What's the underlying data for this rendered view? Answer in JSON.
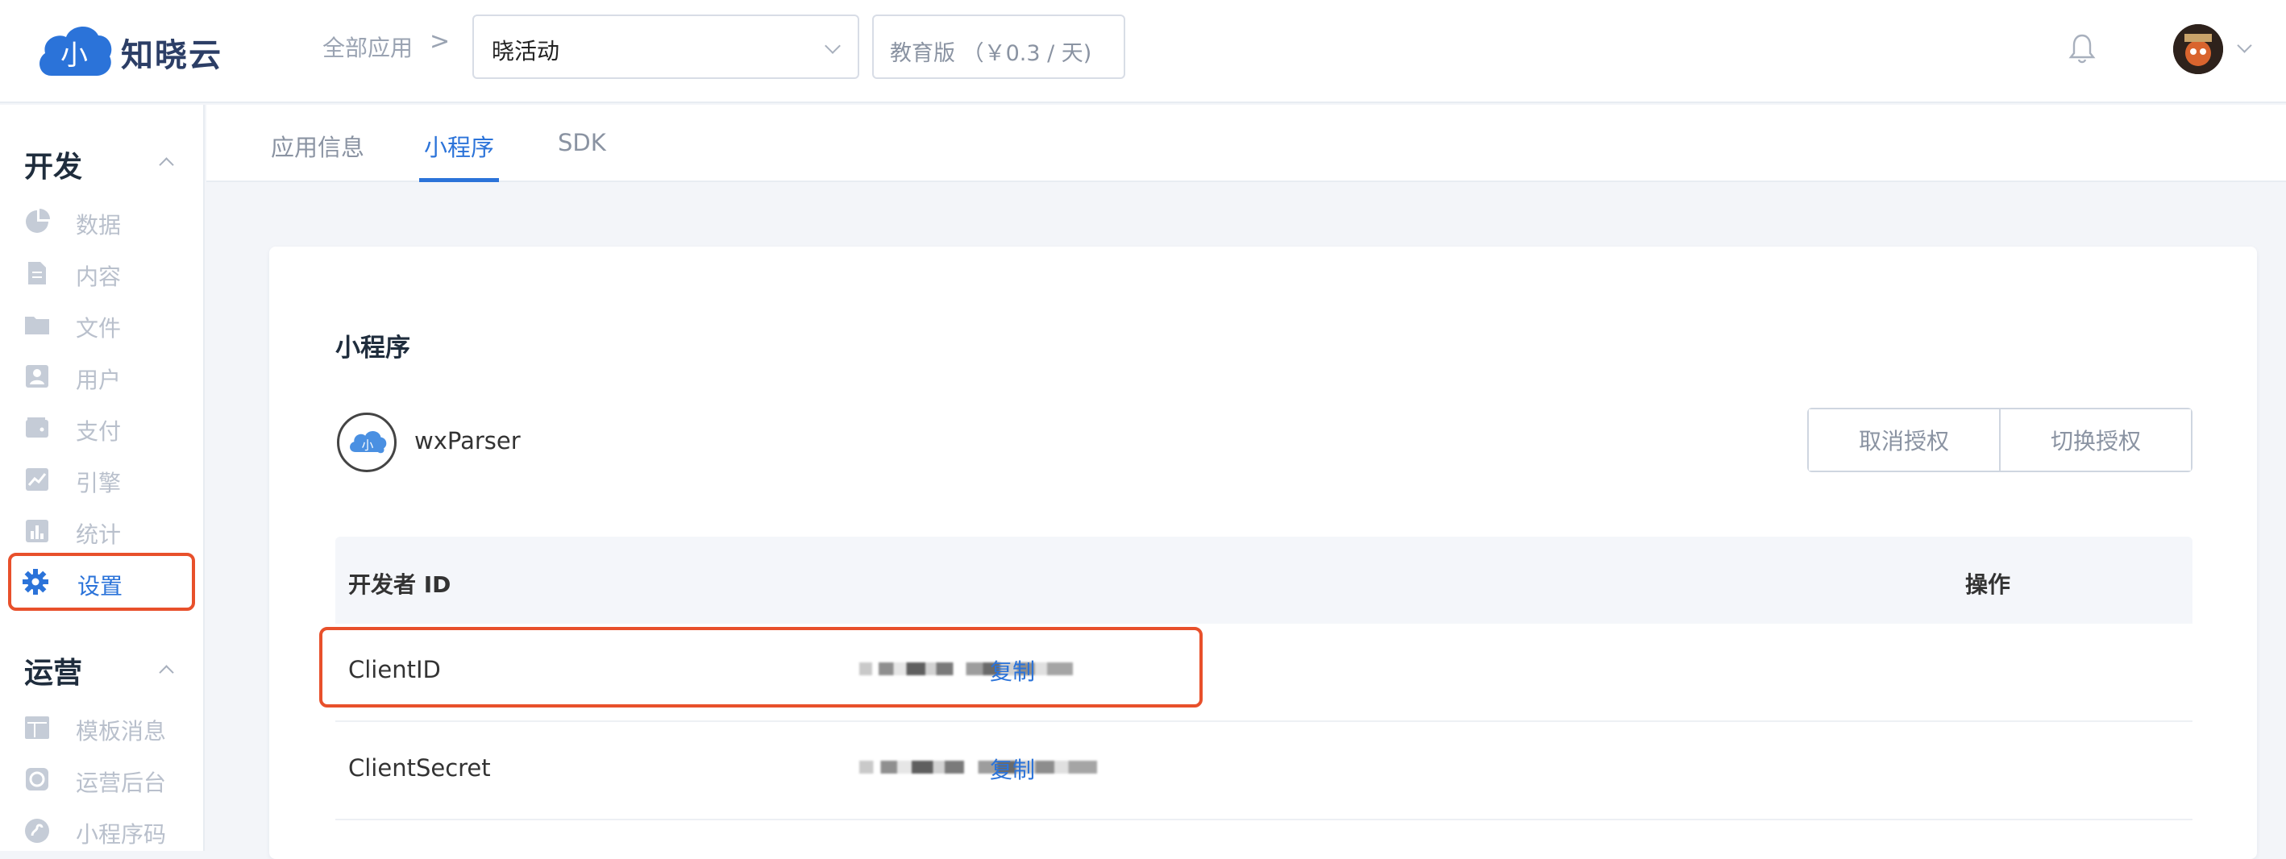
{
  "header": {
    "brand_name": "知晓云",
    "logo_glyph": "小",
    "breadcrumb_all": "全部应用",
    "breadcrumb_separator": ">",
    "app_select_value": "晓活动",
    "edition_label": "教育版 （￥0.3 / 天)",
    "brand_color": "#2b73d9"
  },
  "sidebar": {
    "sections": [
      {
        "title": "开发",
        "items": [
          {
            "label": "数据",
            "icon": "pie-chart-icon"
          },
          {
            "label": "内容",
            "icon": "document-icon"
          },
          {
            "label": "文件",
            "icon": "folder-icon"
          },
          {
            "label": "用户",
            "icon": "user-icon"
          },
          {
            "label": "支付",
            "icon": "wallet-icon"
          },
          {
            "label": "引擎",
            "icon": "trend-icon"
          },
          {
            "label": "统计",
            "icon": "bar-chart-icon"
          },
          {
            "label": "设置",
            "icon": "gear-icon",
            "active": true
          }
        ]
      },
      {
        "title": "运营",
        "items": [
          {
            "label": "模板消息",
            "icon": "template-icon"
          },
          {
            "label": "运营后台",
            "icon": "console-icon"
          },
          {
            "label": "小程序码",
            "icon": "qrcode-icon"
          }
        ]
      }
    ],
    "active_color": "#2b73d9",
    "highlight_color": "#e8502b"
  },
  "tabs": [
    {
      "label": "应用信息",
      "active": false
    },
    {
      "label": "小程序",
      "active": true
    },
    {
      "label": "SDK",
      "active": false
    }
  ],
  "main": {
    "title": "小程序",
    "miniprogram_name": "wxParser",
    "buttons": {
      "revoke": "取消授权",
      "switch": "切换授权"
    },
    "table": {
      "col_id": "开发者 ID",
      "col_action": "操作",
      "rows": [
        {
          "key": "ClientID",
          "value_hidden": true,
          "action": "复制"
        },
        {
          "key": "ClientSecret",
          "value_hidden": true,
          "action": "复制"
        }
      ]
    }
  }
}
